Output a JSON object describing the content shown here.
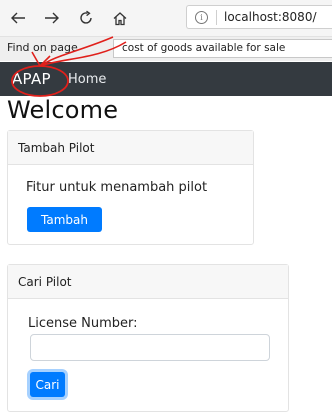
{
  "browser": {
    "back_icon": "arrow-left-icon",
    "forward_icon": "arrow-right-icon",
    "reload_icon": "reload-icon",
    "home_icon": "home-icon",
    "url": "localhost:8080/"
  },
  "find_bar": {
    "label": "Find on page",
    "query": "cost of goods available for sale"
  },
  "navbar": {
    "brand": "APAP",
    "links": [
      "Home"
    ],
    "background": "#343a40",
    "annotation_color": "#e0201b"
  },
  "page": {
    "heading": "Welcome"
  },
  "cards": {
    "tambah": {
      "title": "Tambah Pilot",
      "text": "Fitur untuk menambah pilot",
      "button": "Tambah"
    },
    "cari": {
      "title": "Cari Pilot",
      "field_label": "License Number:",
      "field_value": "",
      "button": "Cari"
    }
  },
  "colors": {
    "primary": "#007bff",
    "card_header_bg": "#f7f7f7"
  }
}
